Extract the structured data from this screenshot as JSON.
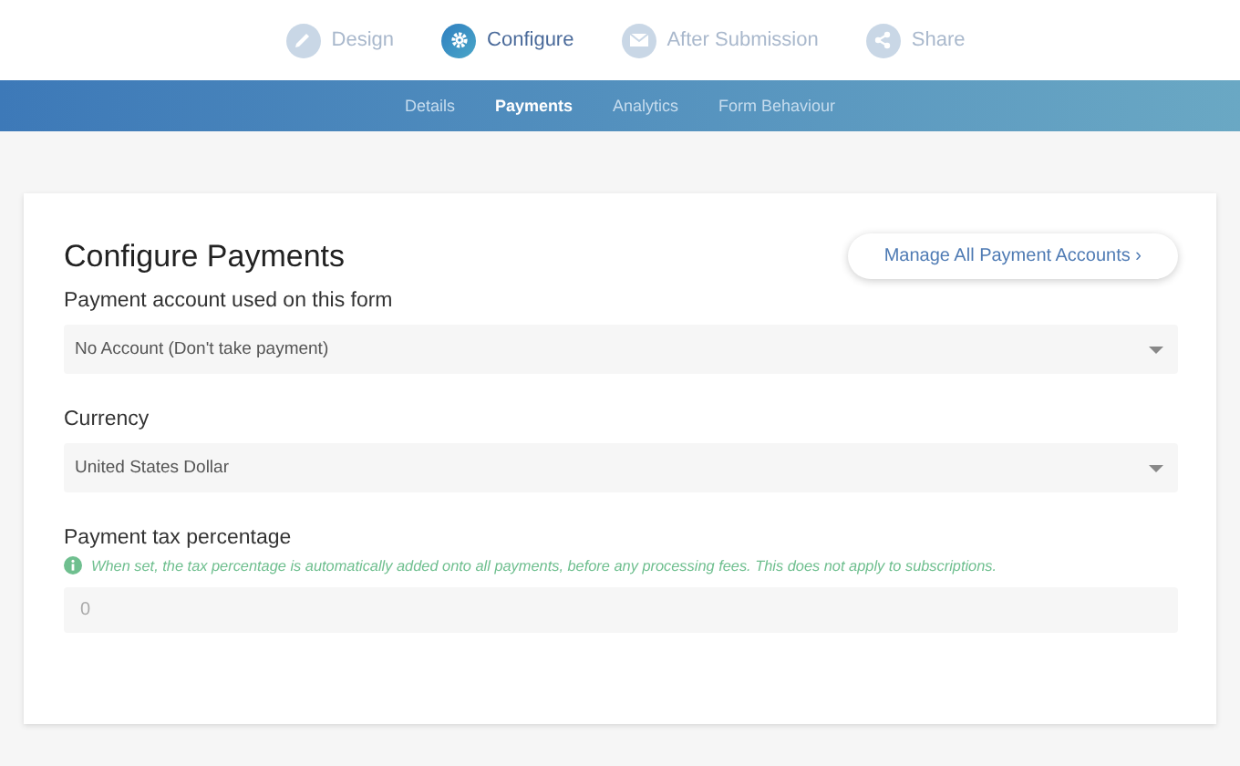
{
  "steps": [
    {
      "label": "Design",
      "kind": "pencil",
      "selected": false
    },
    {
      "label": "Configure",
      "kind": "gear",
      "selected": true
    },
    {
      "label": "After Submission",
      "kind": "envelope",
      "selected": false
    },
    {
      "label": "Share",
      "kind": "share",
      "selected": false
    }
  ],
  "subnav": [
    {
      "label": "Details",
      "selected": false
    },
    {
      "label": "Payments",
      "selected": true
    },
    {
      "label": "Analytics",
      "selected": false
    },
    {
      "label": "Form Behaviour",
      "selected": false
    }
  ],
  "card": {
    "title": "Configure Payments",
    "manage_button": "Manage All Payment Accounts ›",
    "fields": [
      {
        "kind": "select",
        "label": "Payment account used on this form",
        "value": "No Account (Don't take payment)"
      },
      {
        "kind": "select",
        "label": "Currency",
        "value": "United States Dollar"
      },
      {
        "kind": "input",
        "label": "Payment tax percentage",
        "hint": "When set, the tax percentage is automatically added onto all payments, before any processing fees. This does not apply to subscriptions.",
        "placeholder": "0"
      }
    ]
  }
}
